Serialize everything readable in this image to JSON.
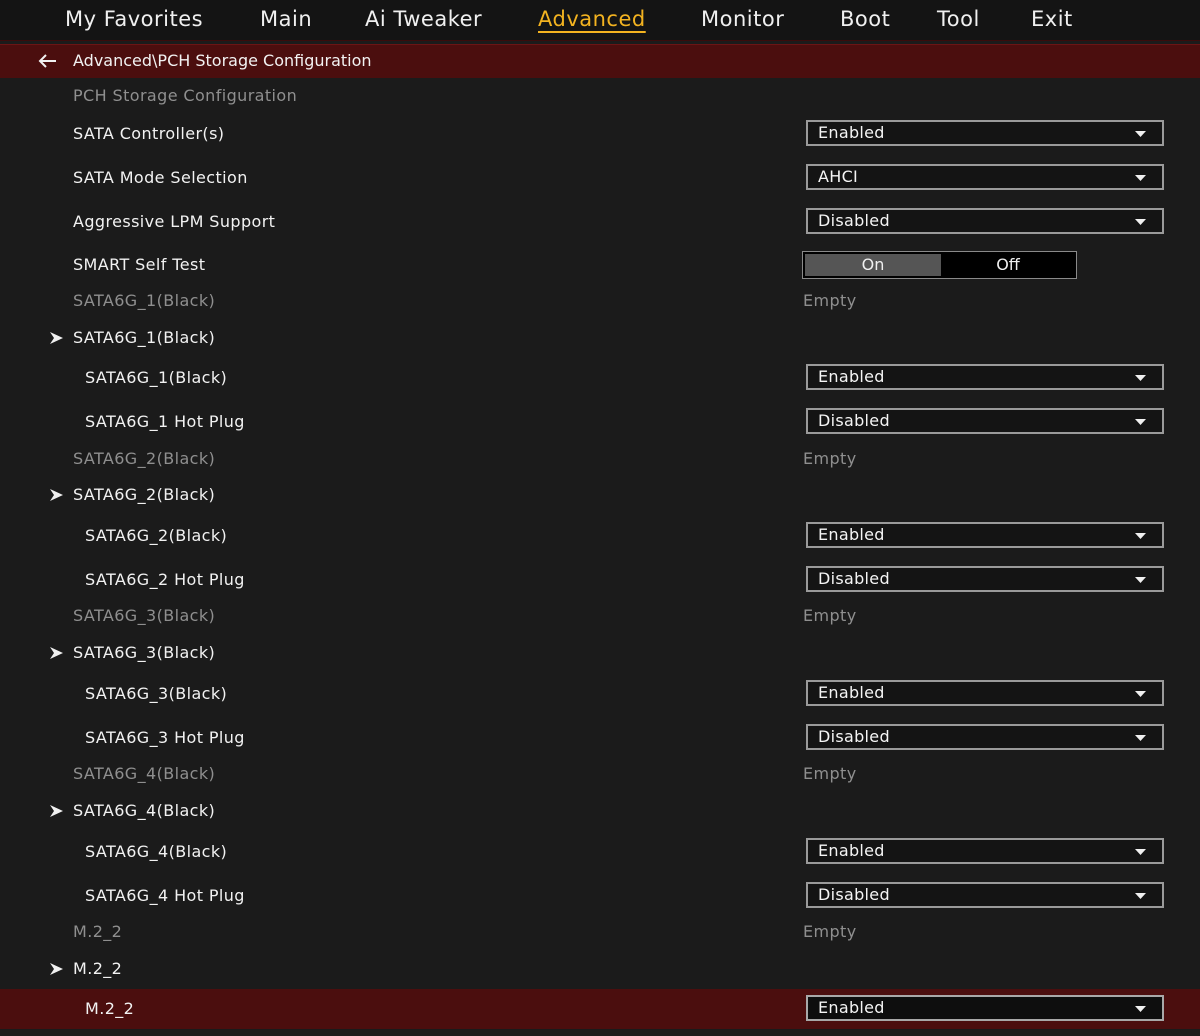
{
  "nav": {
    "tabs": [
      {
        "label": "My Favorites"
      },
      {
        "label": "Main"
      },
      {
        "label": "Ai Tweaker"
      },
      {
        "label": "Advanced"
      },
      {
        "label": "Monitor"
      },
      {
        "label": "Boot"
      },
      {
        "label": "Tool"
      },
      {
        "label": "Exit"
      }
    ],
    "active_tab": "Advanced",
    "active_color": "#f3b320"
  },
  "breadcrumb": {
    "back_icon": "arrow-left-icon",
    "path": "Advanced\\PCH Storage Configuration"
  },
  "colors": {
    "highlight": "#4b0e0e",
    "background": "#1b1b1b",
    "dim_text": "#8f8f8f"
  },
  "settings": {
    "section_title": "PCH Storage Configuration",
    "sata_controllers": {
      "label": "SATA Controller(s)",
      "value": "Enabled"
    },
    "sata_mode": {
      "label": "SATA Mode Selection",
      "value": "AHCI"
    },
    "aggressive_lpm": {
      "label": "Aggressive LPM Support",
      "value": "Disabled"
    },
    "smart_self_test": {
      "label": "SMART Self Test",
      "on_label": "On",
      "off_label": "Off",
      "selected": "On"
    },
    "ports": [
      {
        "info_label": "SATA6G_1(Black)",
        "info_value": "Empty",
        "submenu_label": "SATA6G_1(Black)",
        "enable_label": "SATA6G_1(Black)",
        "enable_value": "Enabled",
        "hotplug_label": "SATA6G_1 Hot Plug",
        "hotplug_value": "Disabled"
      },
      {
        "info_label": "SATA6G_2(Black)",
        "info_value": "Empty",
        "submenu_label": "SATA6G_2(Black)",
        "enable_label": "SATA6G_2(Black)",
        "enable_value": "Enabled",
        "hotplug_label": "SATA6G_2 Hot Plug",
        "hotplug_value": "Disabled"
      },
      {
        "info_label": "SATA6G_3(Black)",
        "info_value": "Empty",
        "submenu_label": "SATA6G_3(Black)",
        "enable_label": "SATA6G_3(Black)",
        "enable_value": "Enabled",
        "hotplug_label": "SATA6G_3 Hot Plug",
        "hotplug_value": "Disabled"
      },
      {
        "info_label": "SATA6G_4(Black)",
        "info_value": "Empty",
        "submenu_label": "SATA6G_4(Black)",
        "enable_label": "SATA6G_4(Black)",
        "enable_value": "Enabled",
        "hotplug_label": "SATA6G_4 Hot Plug",
        "hotplug_value": "Disabled"
      }
    ],
    "m2": {
      "info_label": "M.2_2",
      "info_value": "Empty",
      "submenu_label": "M.2_2",
      "enable_label": "M.2_2",
      "enable_value": "Enabled"
    }
  }
}
